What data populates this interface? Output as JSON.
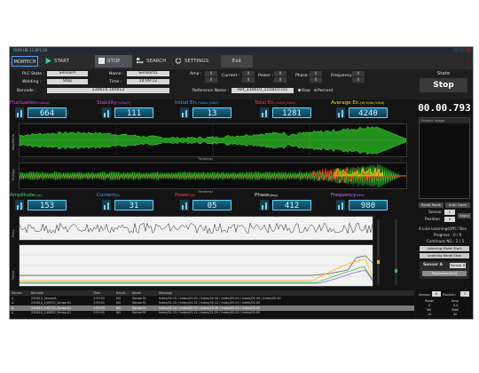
{
  "window_title": "DOM HB 13 BP1.00",
  "toolbar": {
    "logo": "MORTECH",
    "start": "START",
    "stop": "STOP",
    "search": "SEARCH",
    "settings": "SETTINGS",
    "exit": "Exit"
  },
  "info": {
    "plc_state_label": "PLC State :",
    "plc_state": "SensorA",
    "name_label": "Name :",
    "name": "Sensor01",
    "welding_label": "Welding :",
    "welding": "Stop",
    "time_label": "Time :",
    "time": "14:09:12",
    "barcode_label": "Barcode :",
    "barcode": "230610,140912",
    "reference_label": "Reference Name :",
    "reference": "Ref_230610_115810.csv",
    "raw_label": "Raw",
    "percent_label": "Percent",
    "amp_label": "Amp :",
    "current_label": "Current :",
    "power_label": "Power :",
    "phase_label": "Phase :",
    "frequency_label": "Frequency :",
    "spin_a": "0",
    "spin_b": "0"
  },
  "state": {
    "title": "State",
    "value": "Stop"
  },
  "metrics_top": [
    {
      "name": "Fluctuation",
      "unit": "(%Amp)",
      "value": "664",
      "color": "#e14de0"
    },
    {
      "name": "Stability",
      "unit": "(%Std/P)",
      "value": "111",
      "color": "#e14de0"
    },
    {
      "name": "Initial En.",
      "unit": "(%Ave,%Std)",
      "value": "13",
      "color": "#4ea3ff"
    },
    {
      "name": "Total En.",
      "unit": "(%Std,%Ave)",
      "value": "1281",
      "color": "#ff4444"
    },
    {
      "name": "Average En.",
      "unit": "(W,%Std,%Std)",
      "value": "4240",
      "color": "#f5e21a"
    }
  ],
  "metrics_bottom": [
    {
      "name": "Amplitude",
      "unit": "(um)",
      "value": "153",
      "color": "#44dd55"
    },
    {
      "name": "Current",
      "unit": "(A)",
      "value": "31",
      "color": "#4ea3ff"
    },
    {
      "name": "Power",
      "unit": "(W)",
      "value": "05",
      "color": "#ff4444"
    },
    {
      "name": "Phase",
      "unit": "(deg)",
      "value": "412",
      "color": "#e6e6e6"
    },
    {
      "name": "Frequency",
      "unit": "(kHz)",
      "value": "980",
      "color": "#c37bff"
    }
  ],
  "plots": {
    "wave_ylabel": "Waveform",
    "wave_xlabel": "Time(ms)",
    "energy_ylabel": "Energy",
    "energy_xlabel": "Time(ms)",
    "freq_ylabel": "Freq.",
    "trend_ylabel": "Trend"
  },
  "right": {
    "timer": "00.00.793",
    "image_header": "Product Image",
    "reset_label": "Reset Mode",
    "auto_label": "Auto Open",
    "sensor_label": "Sensor",
    "position_label": "Position",
    "sensor_value": "1",
    "position_value": "0",
    "apply_label": "Apply",
    "aline": "A Line Learning(Off) / Dev",
    "progress": "Progress : 0 / 0",
    "continues": "Continues NG : 2 / 5",
    "learning_start": "Learning Mode Start",
    "learning_stop": "Learning Mode Stop",
    "sensor_a": "Sensor A",
    "sensor_a_sel": "Sensor 8",
    "param": "Parameter(mm)"
  },
  "log": {
    "headers": [
      "Sensor",
      "Barcode",
      "Time",
      "Result",
      "Name",
      "Message"
    ],
    "rows": [
      {
        "sensor": "A",
        "barcode": "230610_SensorA",
        "time": "1:59:52",
        "result": "NG",
        "name": "Sensor01",
        "message": "Index/00.15 / Index/03.00 / Index/20.50 / Index/05.00 / Index/05.00 / Index/05.00"
      },
      {
        "sensor": "A",
        "barcode": "230610_140920_Sensor01",
        "time": "1:59:51",
        "result": "NG",
        "name": "Sensor01",
        "message": "Index/01.15 / Index/03.32 / Index/05.12 / Index/05.00 / Index/05.00"
      },
      {
        "sensor": "A",
        "barcode": "230610_140710_Sensor01",
        "time": "1:59:53",
        "result": "NG",
        "name": "Sensor01",
        "message": "Index/02.14 / Index/05.00 / Index/18.30 / Index/05.00 / Index/05.00"
      },
      {
        "sensor": "A",
        "barcode": "230610_140830_Sensor01",
        "time": "1:59:41",
        "result": "NG",
        "name": "Sensor01",
        "message": "Index/01.13 / Index/03.15 / Index/21.25 / Index/05.00 / Index/05.00"
      }
    ]
  },
  "bottom_status": {
    "sensor_label": "Sensor",
    "position_label": "Position",
    "sensor_value": "A",
    "position_value": "1",
    "col1": "Power",
    "col2": "Amp",
    "v1": "0",
    "v2": "0.0",
    "col3": "NG",
    "col4": "Total",
    "v3": "15",
    "v4": "30"
  }
}
